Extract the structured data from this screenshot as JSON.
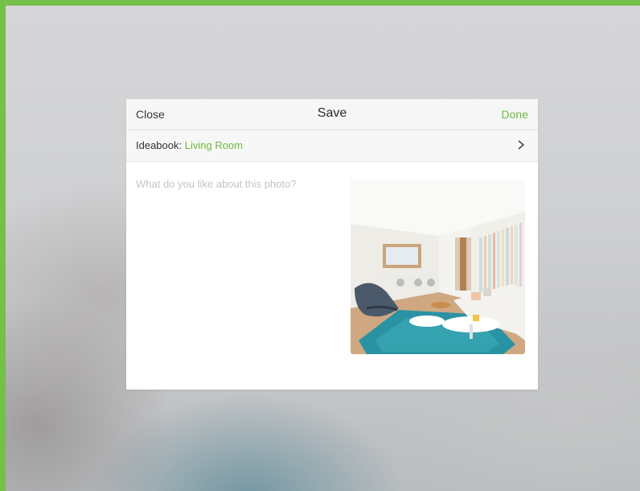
{
  "modal": {
    "close_label": "Close",
    "title": "Save",
    "done_label": "Done"
  },
  "ideabook": {
    "label": "Ideabook:",
    "value": "Living Room"
  },
  "comment": {
    "placeholder": "What do you like about this photo?",
    "value": ""
  },
  "photo": {
    "subject": "living-room-photo"
  },
  "colors": {
    "accent": "#6cba3e",
    "frame_border": "#74c04a"
  }
}
